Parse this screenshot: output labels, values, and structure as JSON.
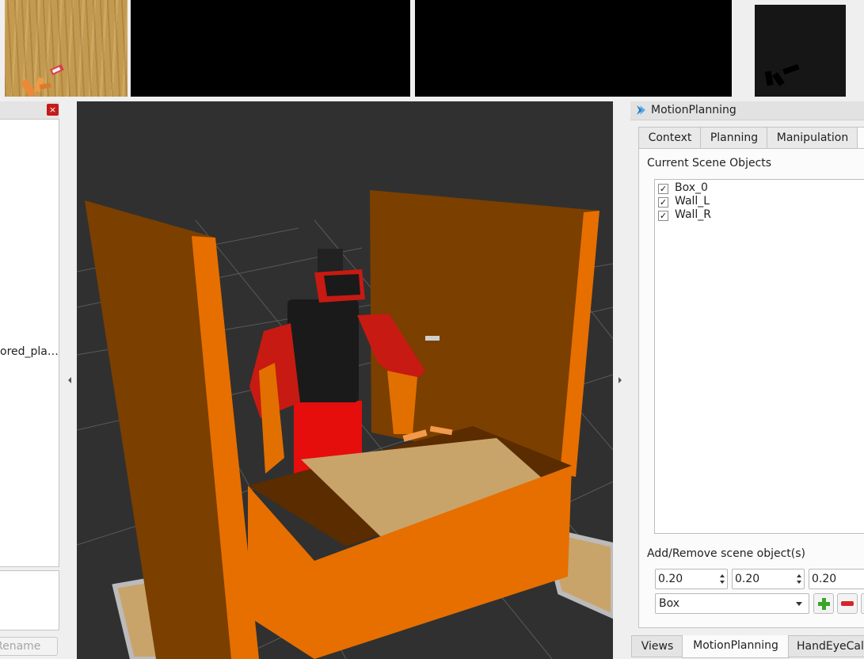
{
  "left_panel": {
    "close_icon_glyph": "×",
    "item_label": "ored_pla…",
    "rename_label": "Rename"
  },
  "motion_planning": {
    "title": "MotionPlanning",
    "tabs": [
      "Context",
      "Planning",
      "Manipulation"
    ],
    "current_scene_objects_label": "Current Scene Objects",
    "scene_objects": [
      {
        "name": "Box_0",
        "checked": true
      },
      {
        "name": "Wall_L",
        "checked": true
      },
      {
        "name": "Wall_R",
        "checked": true
      }
    ],
    "check_glyph": "✓",
    "add_remove_label": "Add/Remove scene object(s)",
    "dimensions": [
      "0.20",
      "0.20",
      "0.20"
    ],
    "shape_selected": "Box"
  },
  "bottom_tabs": [
    "Views",
    "MotionPlanning",
    "HandEyeCali"
  ],
  "colors": {
    "wall_orange": "#e66f00",
    "wall_dark": "#7b3f00",
    "robot_red": "#c71a12",
    "wood": "#c9a46a",
    "viewport_bg": "#303030"
  }
}
